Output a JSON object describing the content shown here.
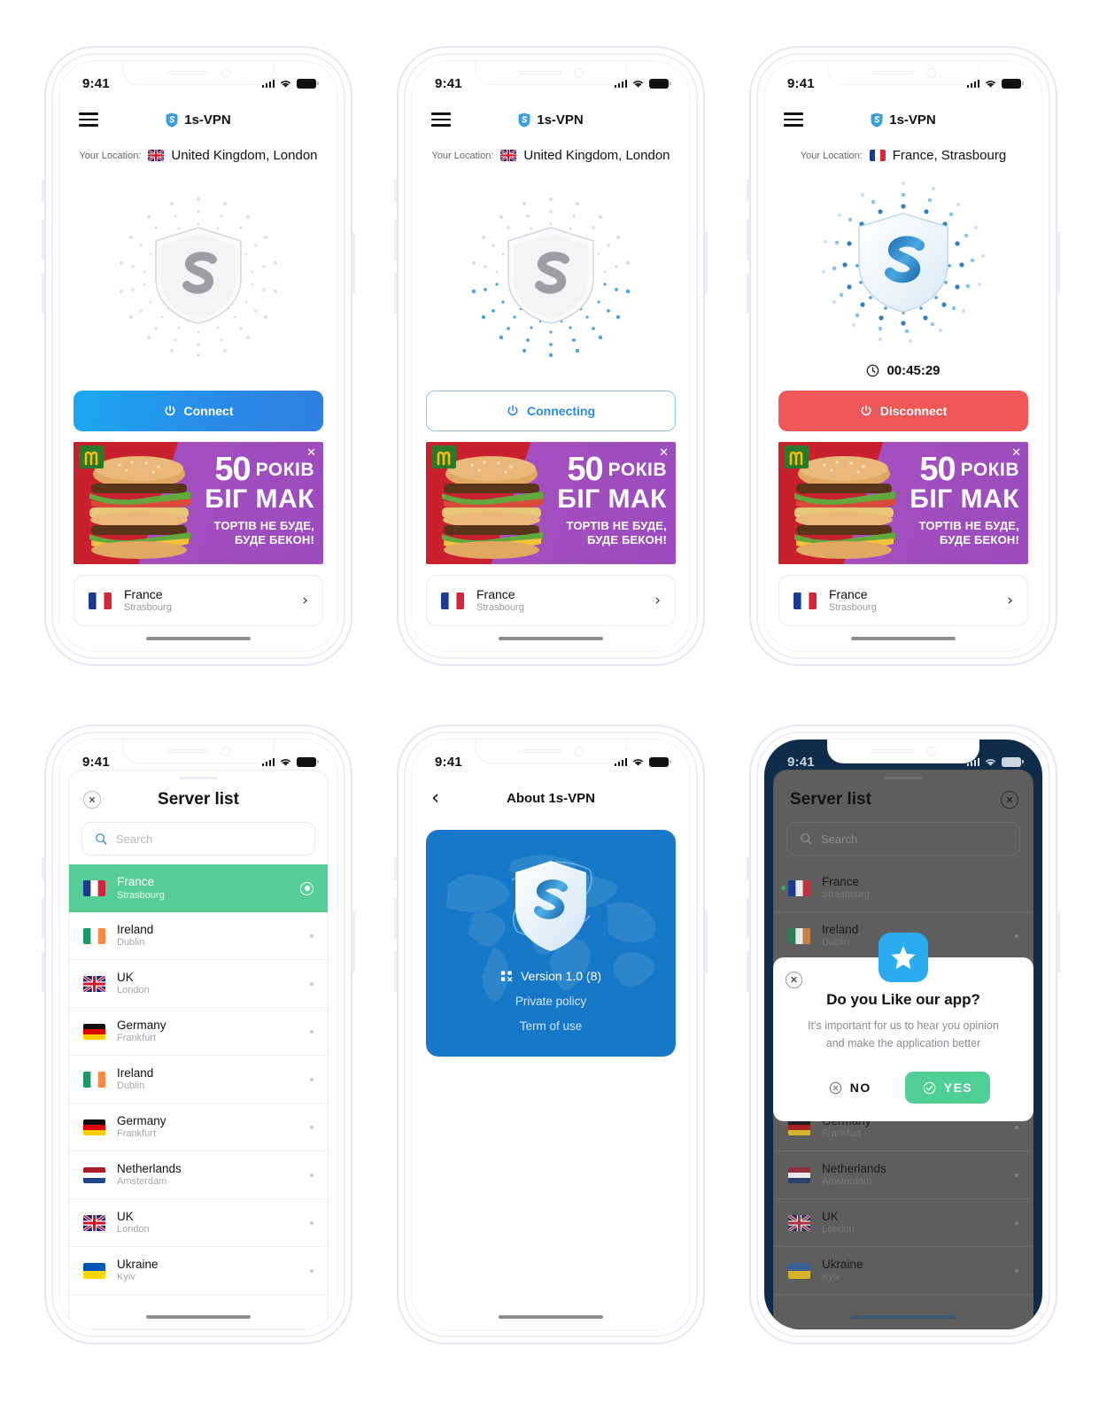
{
  "app": {
    "name": "1s-VPN",
    "logo_icon": "shield-s-icon",
    "menu_icon": "hamburger-menu-icon"
  },
  "status_bar": {
    "time": "9:41",
    "signal_icon": "cellular-signal-icon",
    "wifi_icon": "wifi-icon",
    "battery_icon": "battery-full-icon"
  },
  "screens": {
    "disconnected": {
      "location_label": "Your Location:",
      "location_flag": "gb-flag",
      "location_value": "United Kingdom, London",
      "shield_state": "grey",
      "action_label": "Connect",
      "action_icon": "power-icon",
      "action_style": "filled-blue"
    },
    "connecting": {
      "location_label": "Your Location:",
      "location_flag": "gb-flag",
      "location_value": "United Kingdom, London",
      "shield_state": "partial",
      "action_label": "Connecting",
      "action_icon": "power-icon",
      "action_style": "outline-blue"
    },
    "connected": {
      "location_label": "Your Location:",
      "location_flag": "fr-flag",
      "location_value": "France, Strasbourg",
      "shield_state": "blue",
      "timer_icon": "clock-icon",
      "timer_value": "00:45:29",
      "action_label": "Disconnect",
      "action_icon": "power-icon",
      "action_style": "filled-red"
    },
    "about": {
      "back_icon": "chevron-left-icon",
      "title": "About 1s-VPN",
      "version_icon": "version-icon",
      "version": "Version 1.0 (8)",
      "links": [
        "Private policy",
        "Term of use"
      ]
    },
    "server_list": {
      "title": "Server list",
      "close_icon": "close-circle-icon",
      "search_icon": "search-icon",
      "search_value": "",
      "search_placeholder": "Search"
    },
    "rating_dialog": {
      "close_icon": "close-circle-icon",
      "star_icon": "star-icon",
      "title": "Do you Like our app?",
      "subtitle_line1": "It's important for us to hear you opinion",
      "subtitle_line2": "and make the application better",
      "no_label": "NO",
      "no_icon": "x-circle-icon",
      "yes_label": "YES",
      "yes_icon": "check-circle-icon"
    }
  },
  "selected_server": {
    "flag": "fr-flag",
    "country": "France",
    "city": "Strasbourg",
    "chevron_icon": "chevron-right-icon"
  },
  "servers": [
    {
      "flag": "fr-flag",
      "country": "France",
      "city": "Strasbourg",
      "selected": true
    },
    {
      "flag": "ie-flag",
      "country": "Ireland",
      "city": "Dublin",
      "selected": false
    },
    {
      "flag": "gb-flag",
      "country": "UK",
      "city": "London",
      "selected": false
    },
    {
      "flag": "de-flag",
      "country": "Germany",
      "city": "Frankfurt",
      "selected": false
    },
    {
      "flag": "ie-flag",
      "country": "Ireland",
      "city": "Dublin",
      "selected": false
    },
    {
      "flag": "de-flag",
      "country": "Germany",
      "city": "Frankfurt",
      "selected": false
    },
    {
      "flag": "nl-flag",
      "country": "Netherlands",
      "city": "Amsterdam",
      "selected": false
    },
    {
      "flag": "gb-flag",
      "country": "UK",
      "city": "London",
      "selected": false
    },
    {
      "flag": "ua-flag",
      "country": "Ukraine",
      "city": "Kyiv",
      "selected": false
    }
  ],
  "ad": {
    "brand_icon": "mcdonalds-arches-icon",
    "close_icon": "close-icon",
    "number": "50",
    "word": "РОКІВ",
    "product": "БІГ МАК",
    "line3": "ТОРТІВ НЕ БУДЕ,",
    "line4_plain": "БУДЕ ",
    "line4_bold": "БЕКОН!"
  },
  "colors": {
    "accent_blue": "#2b8ae8",
    "danger_red": "#ed5757",
    "success_green": "#56ce96",
    "ad_purple": "#a44fc0",
    "ad_red": "#c9202e",
    "dark_bg": "#0f2d4a"
  }
}
